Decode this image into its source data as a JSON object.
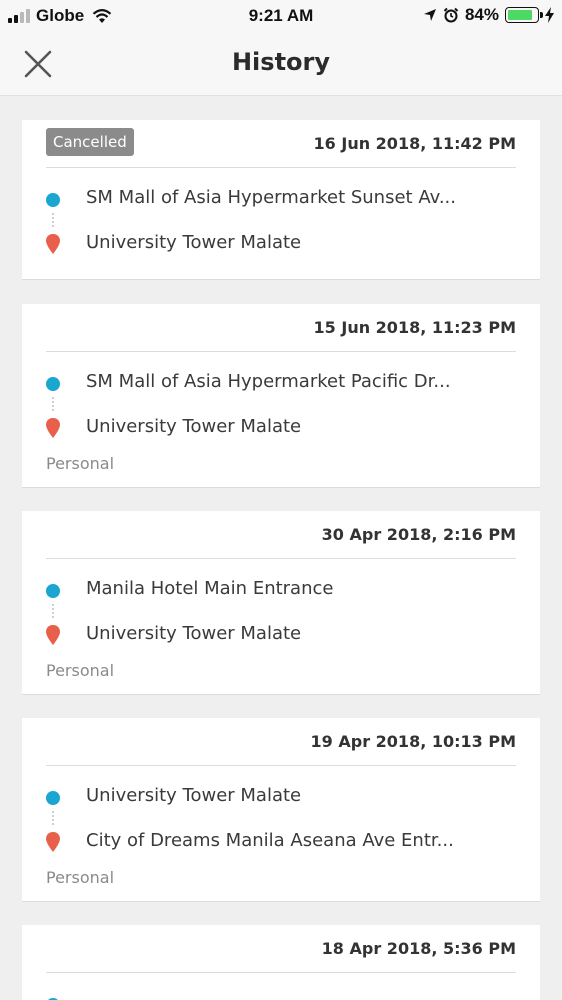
{
  "status_bar": {
    "carrier": "Globe",
    "time": "9:21 AM",
    "battery_percent": "84%",
    "battery_level": 0.84,
    "icons": [
      "signal-icon",
      "wifi-icon",
      "location-arrow-icon",
      "alarm-icon",
      "battery-icon",
      "charging-icon"
    ]
  },
  "header": {
    "title": "History",
    "close_icon": "close-icon"
  },
  "colors": {
    "origin_dot": "#1aa6d0",
    "destination_pin": "#e8604c",
    "badge_bg": "#8b8b8b"
  },
  "trips": [
    {
      "badge": "Cancelled",
      "date": "16 Jun 2018, 11:42 PM",
      "origin": "SM Mall of Asia Hypermarket Sunset Av...",
      "destination": "University Tower Malate",
      "type": ""
    },
    {
      "badge": "",
      "date": "15 Jun 2018, 11:23 PM",
      "origin": "SM Mall of Asia Hypermarket Pacific Dr...",
      "destination": "University Tower Malate",
      "type": "Personal"
    },
    {
      "badge": "",
      "date": "30 Apr 2018, 2:16 PM",
      "origin": "Manila Hotel Main Entrance",
      "destination": "University Tower Malate",
      "type": "Personal"
    },
    {
      "badge": "",
      "date": "19 Apr 2018, 10:13 PM",
      "origin": "University Tower Malate",
      "destination": "City of Dreams Manila Aseana Ave Entr...",
      "type": "Personal"
    },
    {
      "badge": "",
      "date": "18 Apr 2018, 5:36 PM",
      "origin": "",
      "destination": "",
      "type": ""
    }
  ]
}
